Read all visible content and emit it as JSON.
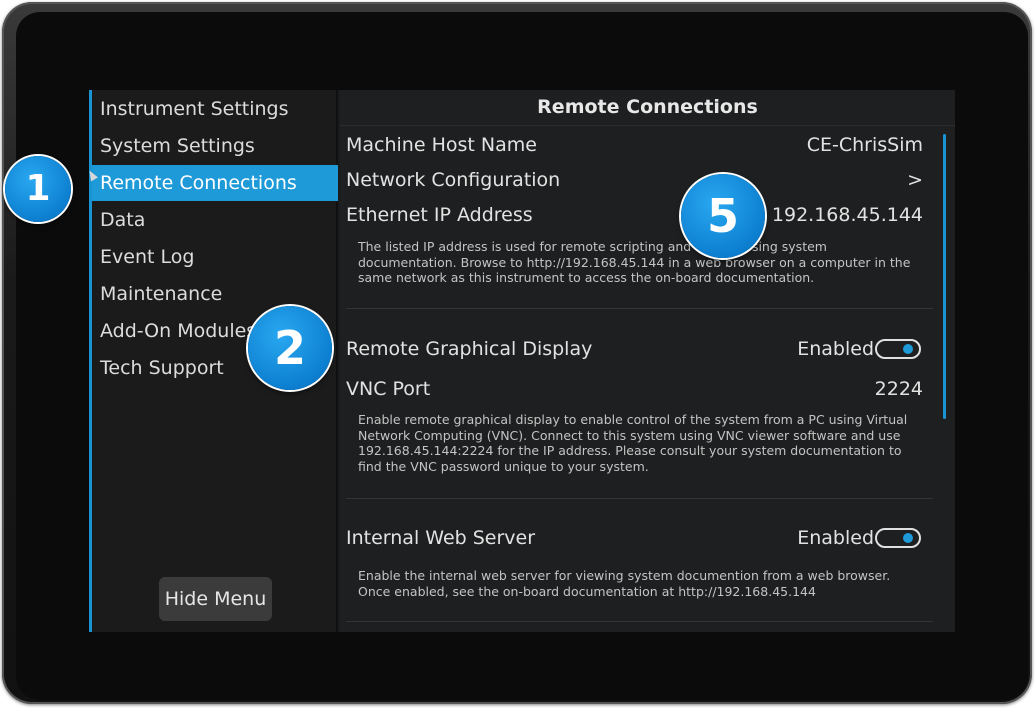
{
  "sidebar": {
    "items": [
      {
        "label": "Instrument Settings",
        "active": false
      },
      {
        "label": "System Settings",
        "active": false
      },
      {
        "label": "Remote Connections",
        "active": true
      },
      {
        "label": "Data",
        "active": false
      },
      {
        "label": "Event Log",
        "active": false
      },
      {
        "label": "Maintenance",
        "active": false
      },
      {
        "label": "Add-On Modules",
        "active": false
      },
      {
        "label": "Tech Support",
        "active": false
      }
    ],
    "hide_menu_label": "Hide Menu"
  },
  "main": {
    "title": "Remote Connections",
    "host_name": {
      "label": "Machine Host Name",
      "value": "CE-ChrisSim"
    },
    "network_config": {
      "label": "Network Configuration",
      "value": ">"
    },
    "ip_address": {
      "label": "Ethernet IP Address",
      "value": "192.168.45.144",
      "description": "The listed IP address is used for remote scripting and for accessing system documentation. Browse to http://192.168.45.144 in a web browser on a computer in the same network as this instrument to access the on-board documentation."
    },
    "remote_display": {
      "label": "Remote Graphical Display",
      "status": "Enabled",
      "enabled": true
    },
    "vnc_port": {
      "label": "VNC Port",
      "value": "2224",
      "description": "Enable remote graphical display to enable control of the system from a PC using Virtual Network Computing (VNC). Connect to this system using VNC viewer software and use 192.168.45.144:2224 for the IP address.  Please consult your system documentation to find the VNC password unique to your system."
    },
    "web_server": {
      "label": "Internal Web Server",
      "status": "Enabled",
      "enabled": true,
      "description": "Enable the internal web server for viewing system documention from a web browser. Once enabled, see the on-board documentation at http://192.168.45.144"
    }
  },
  "callouts": [
    "1",
    "2",
    "5"
  ],
  "colors": {
    "accent": "#1e9ad8",
    "background": "#1e1f20",
    "text": "#e2e2e2"
  }
}
